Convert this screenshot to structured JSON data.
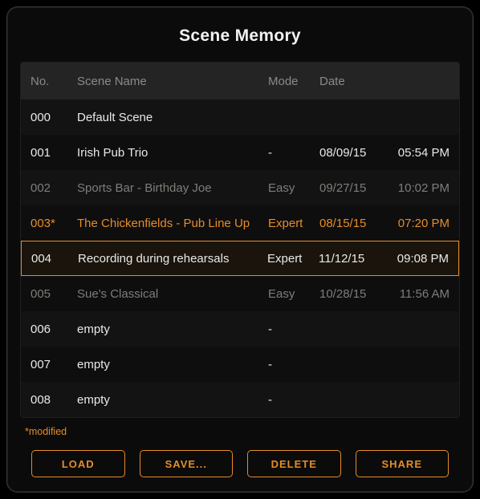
{
  "title": "Scene Memory",
  "columns": {
    "no": "No.",
    "name": "Scene Name",
    "mode": "Mode",
    "date": "Date"
  },
  "rows": [
    {
      "no": "000",
      "name": "Default Scene",
      "mode": "",
      "date": "",
      "time": "",
      "style": "normal"
    },
    {
      "no": "001",
      "name": "Irish Pub Trio",
      "mode": "-",
      "date": "08/09/15",
      "time": "05:54 PM",
      "style": "normal"
    },
    {
      "no": "002",
      "name": "Sports Bar - Birthday Joe",
      "mode": "Easy",
      "date": "09/27/15",
      "time": "10:02 PM",
      "style": "dim"
    },
    {
      "no": "003*",
      "name": "The Chickenfields - Pub Line Up",
      "mode": "Expert",
      "date": "08/15/15",
      "time": "07:20 PM",
      "style": "highlight"
    },
    {
      "no": "004",
      "name": "Recording during rehearsals",
      "mode": "Expert",
      "date": "11/12/15",
      "time": "09:08 PM",
      "style": "selected"
    },
    {
      "no": "005",
      "name": "Sue's Classical",
      "mode": "Easy",
      "date": "10/28/15",
      "time": "11:56 AM",
      "style": "dim"
    },
    {
      "no": "006",
      "name": "empty",
      "mode": "-",
      "date": "",
      "time": "",
      "style": "normal"
    },
    {
      "no": "007",
      "name": "empty",
      "mode": "-",
      "date": "",
      "time": "",
      "style": "normal"
    },
    {
      "no": "008",
      "name": "empty",
      "mode": "-",
      "date": "",
      "time": "",
      "style": "normal"
    }
  ],
  "footnote": "*modified",
  "buttons": {
    "load": "LOAD",
    "save": "SAVE...",
    "delete": "DELETE",
    "share": "SHARE"
  }
}
